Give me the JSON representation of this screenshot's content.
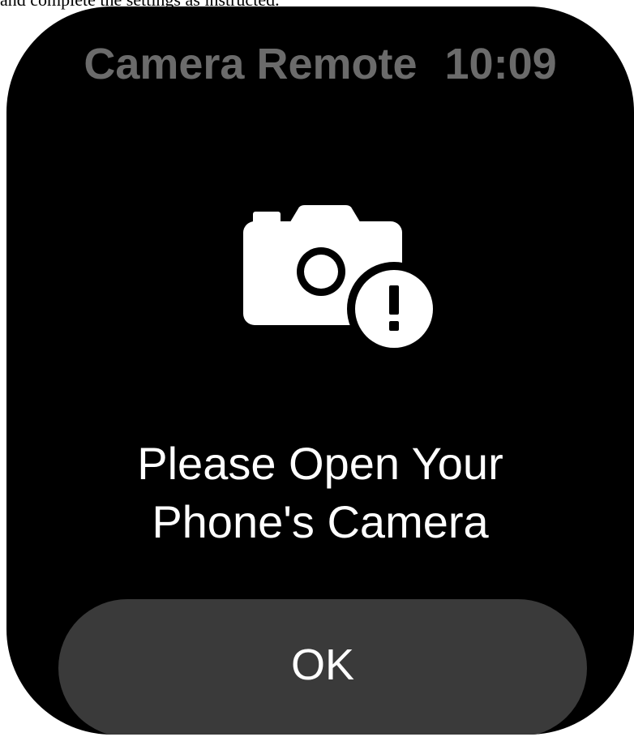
{
  "top_caption": "and complete the settings as instructed.",
  "status_bar": {
    "app_title": "Camera Remote",
    "time": "10:09"
  },
  "icon": {
    "name": "camera-alert-icon",
    "alert_glyph": "!"
  },
  "message": {
    "line1": "Please Open Your",
    "line2": "Phone's Camera"
  },
  "ok_button": {
    "label": "OK"
  },
  "colors": {
    "screen_background": "#000000",
    "status_text": "#6b6b6b",
    "primary_text": "#ffffff",
    "button_background": "#3a3a3a"
  }
}
